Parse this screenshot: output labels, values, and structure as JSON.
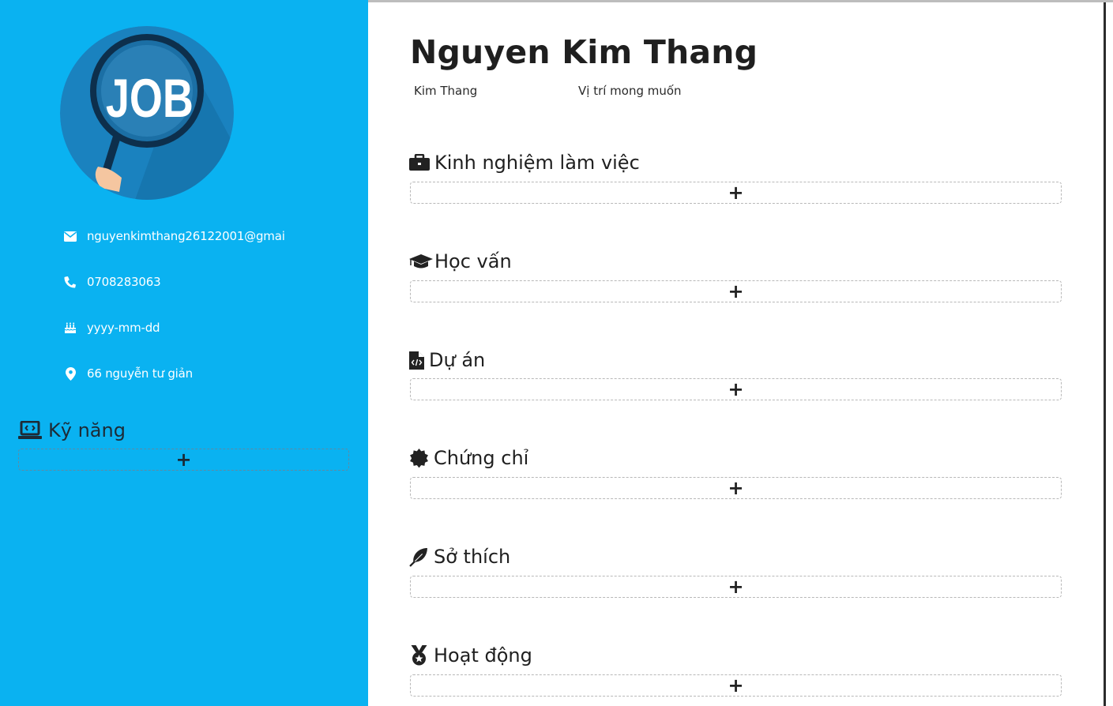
{
  "profile": {
    "avatar_label": "JOB",
    "name": "Nguyen Kim Thang",
    "short_name": "Kim Thang",
    "desired_position": "Vị trí mong muốn"
  },
  "contacts": {
    "email": "nguyenkimthang26122001@gmai",
    "phone": "0708283063",
    "birthday": "yyyy-mm-dd",
    "address": "66 nguyễn tư giản"
  },
  "skills": {
    "title": "Kỹ năng",
    "add_label": "+"
  },
  "sections": [
    {
      "title": "Kinh nghiệm làm việc",
      "icon": "briefcase-icon",
      "add_label": "+"
    },
    {
      "title": "Học vấn",
      "icon": "graduation-cap-icon",
      "add_label": "+"
    },
    {
      "title": "Dự án",
      "icon": "file-code-icon",
      "add_label": "+"
    },
    {
      "title": "Chứng chỉ",
      "icon": "certificate-icon",
      "add_label": "+"
    },
    {
      "title": "Sở thích",
      "icon": "feather-icon",
      "add_label": "+"
    },
    {
      "title": "Hoạt động",
      "icon": "medal-icon",
      "add_label": "+"
    }
  ],
  "colors": {
    "sidebar": "#0ab2f1",
    "text_dark": "#1f1f1f"
  }
}
